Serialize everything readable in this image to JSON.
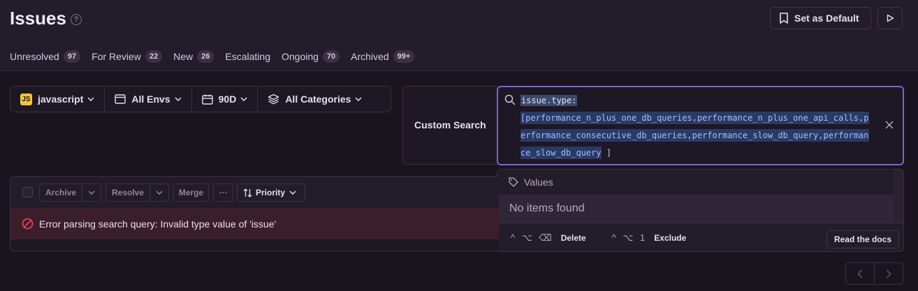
{
  "page": {
    "title": "Issues",
    "help_icon": "?"
  },
  "header": {
    "default_button_label": "Set as Default"
  },
  "tabs": [
    {
      "label": "Unresolved",
      "count": "97"
    },
    {
      "label": "For Review",
      "count": "22"
    },
    {
      "label": "New",
      "count": "26"
    },
    {
      "label": "Escalating",
      "count": ""
    },
    {
      "label": "Ongoing",
      "count": "70"
    },
    {
      "label": "Archived",
      "count": "99+"
    }
  ],
  "filters": {
    "project_badge": "JS",
    "project": "javascript",
    "environment": "All Envs",
    "date_range": "90D",
    "categories": "All Categories"
  },
  "search": {
    "label": "Custom Search",
    "key": "issue.type:",
    "value": "[performance_n_plus_one_db_queries,performance_n_plus_one_api_calls,performance_consecutive_db_queries,performance_slow_db_query,performance_slow_db_query",
    "value_tail": " ]"
  },
  "dropdown": {
    "section": "Values",
    "empty": "No items found",
    "hint_delete_keys": "^ ⌥ ⌫",
    "hint_delete": "Delete",
    "hint_exclude_keys": "^ ⌥ 1",
    "hint_exclude": "Exclude",
    "docs_button": "Read the docs"
  },
  "toolbar": {
    "archive": "Archive",
    "resolve": "Resolve",
    "merge": "Merge",
    "more": "···",
    "priority": "Priority"
  },
  "error": {
    "message": "Error parsing search query: Invalid type value of 'issue'"
  },
  "colors": {
    "accent": "#7b64d8",
    "error_bg": "#3a1f2a",
    "js_badge": "#f0c53b"
  }
}
